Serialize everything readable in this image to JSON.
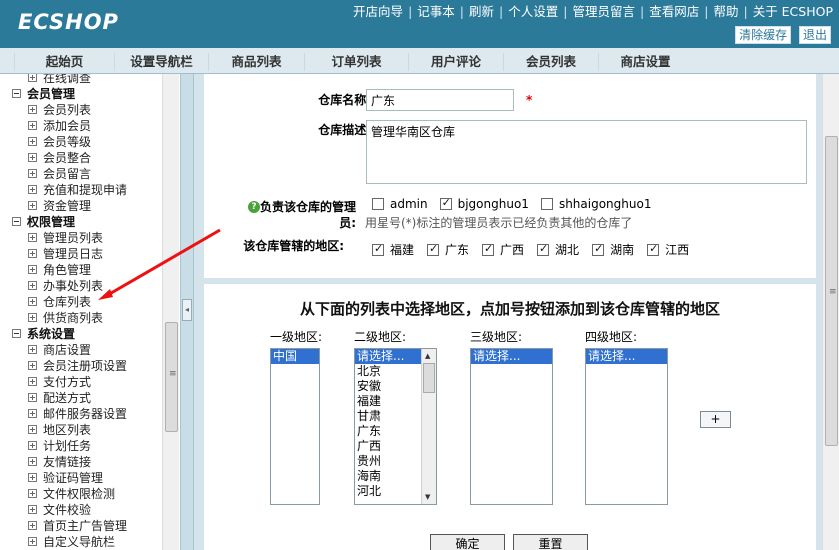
{
  "header": {
    "logo": "ECSHOP",
    "top_links": [
      "开店向导",
      "记事本",
      "刷新",
      "个人设置",
      "管理员留言",
      "查看网店",
      "帮助",
      "关于 ECSHOP"
    ],
    "clear_cache": "清除缓存",
    "logout": "退出"
  },
  "nav": {
    "tabs": [
      "起始页",
      "设置导航栏",
      "商品列表",
      "订单列表",
      "用户评论",
      "会员列表",
      "商店设置"
    ]
  },
  "menu": [
    {
      "type": "item",
      "label": "在线调查"
    },
    {
      "type": "group",
      "label": "会员管理"
    },
    {
      "type": "item",
      "label": "会员列表"
    },
    {
      "type": "item",
      "label": "添加会员"
    },
    {
      "type": "item",
      "label": "会员等级"
    },
    {
      "type": "item",
      "label": "会员整合"
    },
    {
      "type": "item",
      "label": "会员留言"
    },
    {
      "type": "item",
      "label": "充值和提现申请"
    },
    {
      "type": "item",
      "label": "资金管理"
    },
    {
      "type": "group",
      "label": "权限管理"
    },
    {
      "type": "item",
      "label": "管理员列表"
    },
    {
      "type": "item",
      "label": "管理员日志"
    },
    {
      "type": "item",
      "label": "角色管理"
    },
    {
      "type": "item",
      "label": "办事处列表"
    },
    {
      "type": "item",
      "label": "仓库列表"
    },
    {
      "type": "item",
      "label": "供货商列表"
    },
    {
      "type": "group",
      "label": "系统设置"
    },
    {
      "type": "item",
      "label": "商店设置"
    },
    {
      "type": "item",
      "label": "会员注册项设置"
    },
    {
      "type": "item",
      "label": "支付方式"
    },
    {
      "type": "item",
      "label": "配送方式"
    },
    {
      "type": "item",
      "label": "邮件服务器设置"
    },
    {
      "type": "item",
      "label": "地区列表"
    },
    {
      "type": "item",
      "label": "计划任务"
    },
    {
      "type": "item",
      "label": "友情链接"
    },
    {
      "type": "item",
      "label": "验证码管理"
    },
    {
      "type": "item",
      "label": "文件权限检测"
    },
    {
      "type": "item",
      "label": "文件校验"
    },
    {
      "type": "item",
      "label": "首页主广告管理"
    },
    {
      "type": "item",
      "label": "自定义导航栏"
    }
  ],
  "form": {
    "name_label": "仓库名称:",
    "name_value": "广东",
    "required_mark": "*",
    "desc_label": "仓库描述:",
    "desc_value": "管理华南区仓库",
    "managers_label_1": "负责该仓库的管理",
    "managers_label_2": "员:",
    "managers": [
      {
        "name": "admin",
        "checked": false
      },
      {
        "name": "bjgonghuo1",
        "checked": true
      },
      {
        "name": "shhaigonghuo1",
        "checked": false
      }
    ],
    "managers_note": "用星号(*)标注的管理员表示已经负责其他的仓库了",
    "regions_label": "该仓库管辖的地区:",
    "regions": [
      "福建",
      "广东",
      "广西",
      "湖北",
      "湖南",
      "江西"
    ]
  },
  "region_picker": {
    "title": "从下面的列表中选择地区，点加号按钮添加到该仓库管辖的地区",
    "level1_label": "一级地区:",
    "level2_label": "二级地区:",
    "level3_label": "三级地区:",
    "level4_label": "四级地区:",
    "level1_options": [
      "中国"
    ],
    "level2_options": [
      "请选择...",
      "北京",
      "安徽",
      "福建",
      "甘肃",
      "广东",
      "广西",
      "贵州",
      "海南",
      "河北"
    ],
    "level3_options": [
      "请选择..."
    ],
    "level4_options": [
      "请选择..."
    ],
    "add_button": "+",
    "confirm_button": "确定",
    "reset_button": "重置"
  }
}
